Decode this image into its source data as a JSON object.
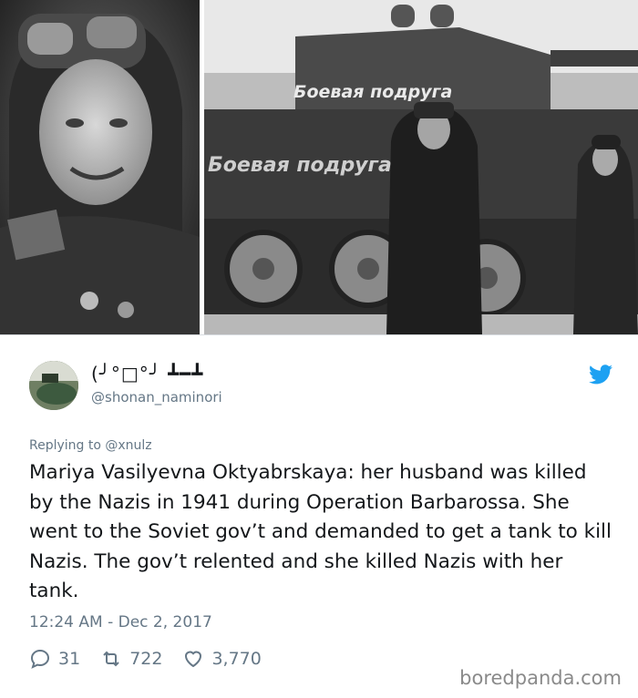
{
  "photos": {
    "left": {
      "description_icon": "female-soldier-photo"
    },
    "right": {
      "tank_slogan": "Боевая подруга",
      "tank_slogan_side": "Боевая подруга"
    }
  },
  "tweet": {
    "display_name": "(╯°□°╯ ┻━┻",
    "handle": "@shonan_naminori",
    "replying_to": "Replying to @xnulz",
    "text": "Mariya Vasilyevna Oktyabrskaya: her husband was killed by the Nazis in 1941 during Operation Barbarossa. She went to the Soviet gov’t and demanded to get a tank to kill Nazis. The gov’t relented and she killed Nazis with her tank.",
    "timestamp": "12:24 AM - Dec 2, 2017",
    "counts": {
      "replies": "31",
      "retweets": "722",
      "likes": "3,770"
    }
  },
  "watermark": "boredpanda.com",
  "colors": {
    "twitter_blue": "#1da1f2",
    "muted": "#657786"
  },
  "icons": [
    "twitter-bird-icon",
    "reply-icon",
    "retweet-icon",
    "like-icon"
  ]
}
